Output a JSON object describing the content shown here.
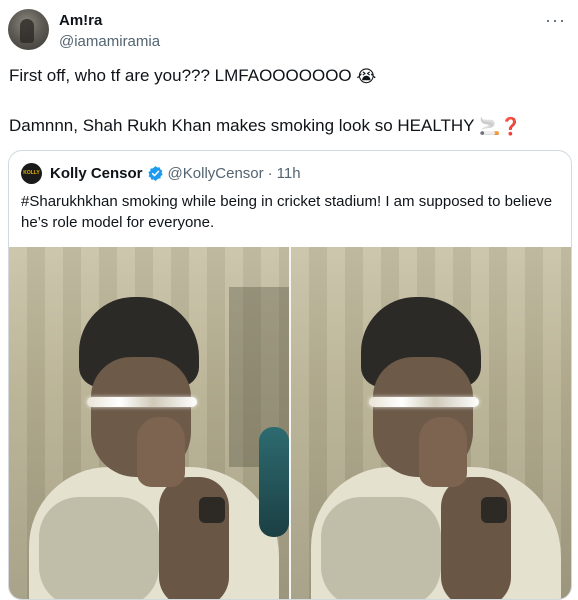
{
  "tweet": {
    "display_name": "Am!ra",
    "handle": "@iamamiramia",
    "more_label": "···",
    "line1": "First off, who tf are you??? LMFAOOOOOOO",
    "line1_emoji": "😭",
    "line2": "Damnnn, Shah Rukh Khan makes smoking look so HEALTHY",
    "line2_emoji": "🚬❓"
  },
  "quote": {
    "avatar_text": "KOLLY",
    "name": "Kolly Censor",
    "handle": "@KollyCensor",
    "dot": "·",
    "time": "11h",
    "text": "#Sharukhkhan smoking while being in cricket stadium! I am supposed to believe he’s role model for everyone.",
    "verified_color": "#1d9bf0"
  },
  "icons": [
    "more-icon",
    "verified-badge-icon"
  ]
}
